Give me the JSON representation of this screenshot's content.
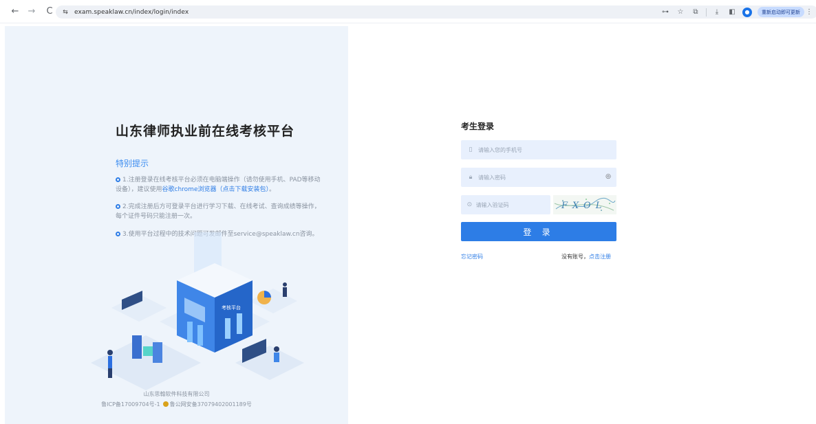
{
  "browser": {
    "url": "exam.speaklaw.cn/index/login/index",
    "back_icon": "←",
    "forward_icon": "→",
    "reload_icon": "C",
    "site_info_icon": "⇆",
    "key_icon": "⊶",
    "star_icon": "☆",
    "extensions_icon": "⧉",
    "download_icon": "⤓",
    "sidepanel_icon": "◧",
    "menu_icon": "⋮",
    "update_label": "重新启动即可更新"
  },
  "left": {
    "title": "山东律师执业前在线考核平台",
    "notice_title": "特别提示",
    "notice1_text": "1.注册登录在线考核平台必须在电脑端操作（请勿使用手机、PAD等移动设备），建议使用",
    "notice1_link": "谷歌chrome浏览器（点击下载安装包）",
    "notice1_end": "。",
    "notice2_text": "2.完成注册后方可登录平台进行学习下载、在线考试、查询成绩等操作，每个证件号码只能注册一次。",
    "notice3_text": "3.使用平台过程中的技术问题可发邮件至service@speaklaw.cn咨询。",
    "illustration_label": "考核平台",
    "footer_company": "山东思翰软件科技有限公司",
    "footer_icp": "鲁ICP备17009704号-1",
    "footer_police": "鲁公网安备37079402001189号"
  },
  "login": {
    "title": "考生登录",
    "phone_placeholder": "请输入您的手机号",
    "password_placeholder": "请输入密码",
    "captcha_placeholder": "请输入验证码",
    "captcha_text": "FXOL",
    "submit_label": "登 录",
    "forgot_label": "忘记密码",
    "no_account_label": "没有账号，",
    "register_label": "点击注册"
  },
  "colors": {
    "accent": "#2d7de6",
    "panel_bg": "#eef4fb",
    "field_bg": "#e8f0fd"
  }
}
